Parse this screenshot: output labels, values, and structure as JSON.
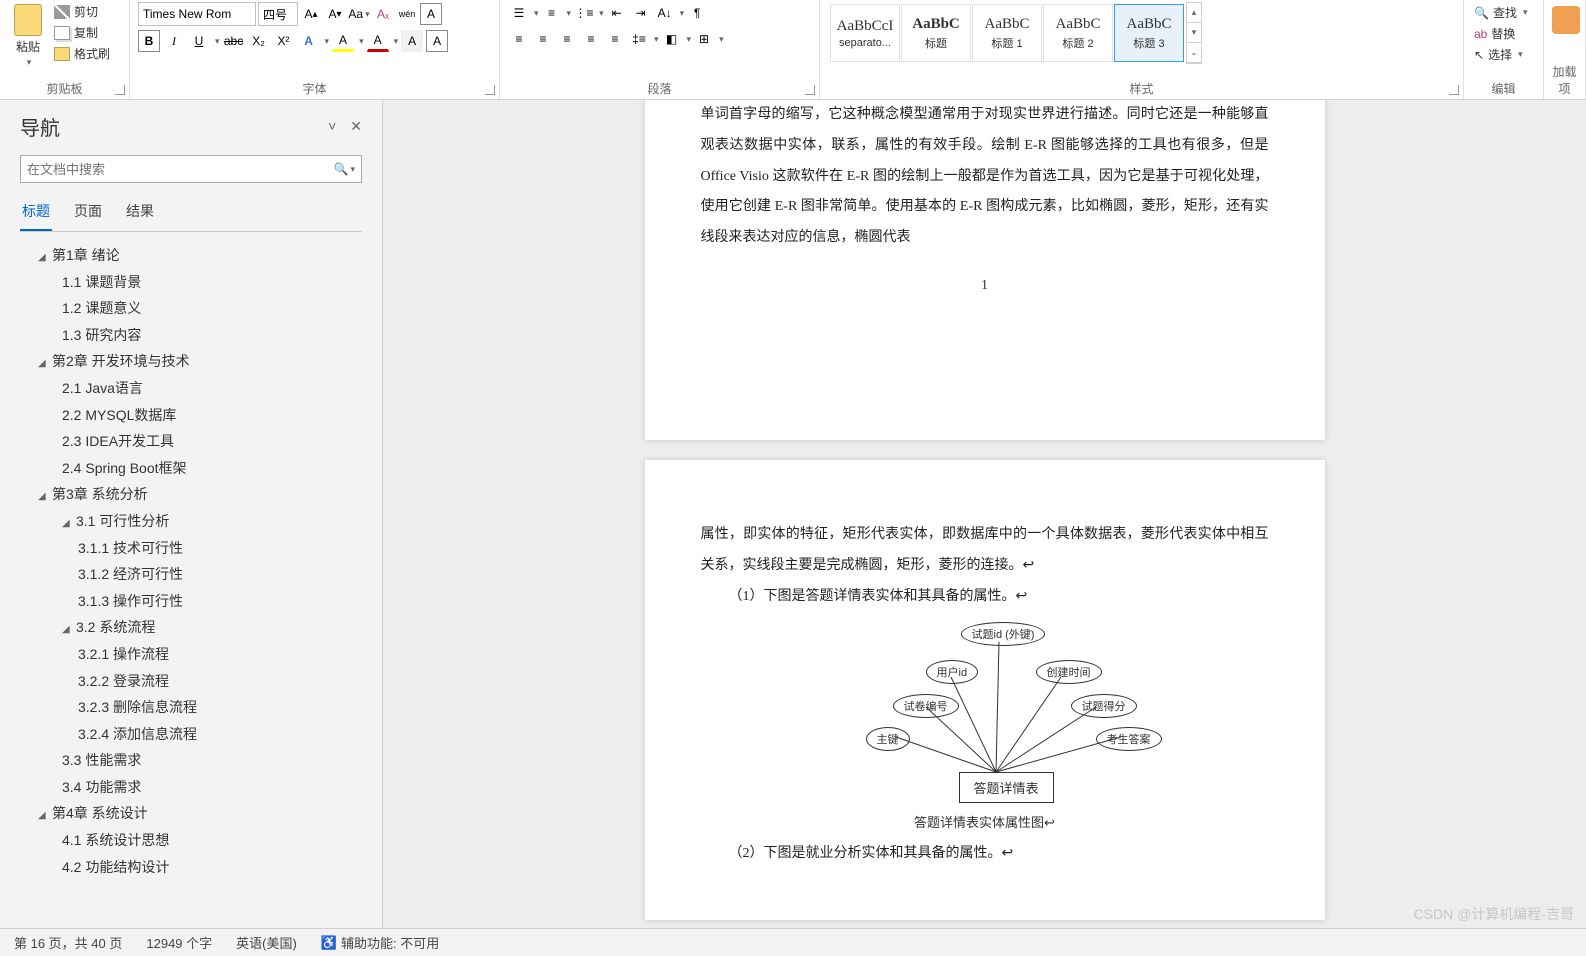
{
  "ribbon": {
    "clipboard": {
      "paste": "粘贴",
      "cut": "剪切",
      "copy": "复制",
      "brush": "格式刷",
      "label": "剪贴板"
    },
    "font": {
      "name": "Times New Rom",
      "size": "四号",
      "grow": "A",
      "shrink": "A",
      "case": "Aa",
      "clear": "Aₓ",
      "phonetic": "wén",
      "charbox": "A",
      "bold": "B",
      "italic": "I",
      "underline": "U",
      "strike": "abc",
      "sub": "X₂",
      "sup": "X²",
      "effects": "A",
      "highlight": "A",
      "fontcolor": "A",
      "charshade": "A",
      "charborder": "A",
      "label": "字体"
    },
    "para": {
      "label": "段落"
    },
    "styles": {
      "items": [
        {
          "preview": "AaBbCcI",
          "name": "separato...",
          "bold": false
        },
        {
          "preview": "AaBbC",
          "name": "标题",
          "bold": true
        },
        {
          "preview": "AaBbC",
          "name": "标题 1",
          "bold": false
        },
        {
          "preview": "AaBbC",
          "name": "标题 2",
          "bold": false
        },
        {
          "preview": "AaBbC",
          "name": "标题 3",
          "bold": false
        }
      ],
      "selected": 4,
      "label": "样式"
    },
    "edit": {
      "find": "查找",
      "replace": "替换",
      "select": "选择",
      "label": "编辑"
    },
    "addin": {
      "label": "加载项"
    }
  },
  "nav": {
    "title": "导航",
    "collapse": "˅",
    "close": "✕",
    "search_placeholder": "在文档中搜索",
    "tabs": {
      "headings": "标题",
      "pages": "页面",
      "results": "结果"
    },
    "tree": [
      {
        "lvl": 1,
        "caret": true,
        "text": "第1章 绪论"
      },
      {
        "lvl": 2,
        "caret": false,
        "text": "1.1 课题背景"
      },
      {
        "lvl": 2,
        "caret": false,
        "text": "1.2 课题意义"
      },
      {
        "lvl": 2,
        "caret": false,
        "text": "1.3 研究内容"
      },
      {
        "lvl": 1,
        "caret": true,
        "text": "第2章 开发环境与技术"
      },
      {
        "lvl": 2,
        "caret": false,
        "text": "2.1 Java语言"
      },
      {
        "lvl": 2,
        "caret": false,
        "text": "2.2 MYSQL数据库"
      },
      {
        "lvl": 2,
        "caret": false,
        "text": "2.3 IDEA开发工具"
      },
      {
        "lvl": 2,
        "caret": false,
        "text": "2.4 Spring Boot框架"
      },
      {
        "lvl": 1,
        "caret": true,
        "text": "第3章 系统分析"
      },
      {
        "lvl": 2,
        "caret": true,
        "text": "3.1 可行性分析"
      },
      {
        "lvl": 3,
        "caret": false,
        "text": "3.1.1 技术可行性"
      },
      {
        "lvl": 3,
        "caret": false,
        "text": "3.1.2 经济可行性"
      },
      {
        "lvl": 3,
        "caret": false,
        "text": "3.1.3 操作可行性"
      },
      {
        "lvl": 2,
        "caret": true,
        "text": "3.2 系统流程"
      },
      {
        "lvl": 3,
        "caret": false,
        "text": "3.2.1 操作流程"
      },
      {
        "lvl": 3,
        "caret": false,
        "text": "3.2.2 登录流程"
      },
      {
        "lvl": 3,
        "caret": false,
        "text": "3.2.3 删除信息流程"
      },
      {
        "lvl": 3,
        "caret": false,
        "text": "3.2.4 添加信息流程"
      },
      {
        "lvl": 2,
        "caret": false,
        "text": "3.3 性能需求"
      },
      {
        "lvl": 2,
        "caret": false,
        "text": "3.4 功能需求"
      },
      {
        "lvl": 1,
        "caret": true,
        "text": "第4章 系统设计"
      },
      {
        "lvl": 2,
        "caret": false,
        "text": "4.1 系统设计思想"
      },
      {
        "lvl": 2,
        "caret": false,
        "text": "4.2 功能结构设计"
      }
    ]
  },
  "doc": {
    "page1_text": "单词首字母的缩写，它这种概念模型通常用于对现实世界进行描述。同时它还是一种能够直观表达数据中实体，联系，属性的有效手段。绘制 E-R 图能够选择的工具也有很多，但是 Office Visio 这款软件在 E-R 图的绘制上一般都是作为首选工具，因为它是基于可视化处理，使用它创建 E-R 图非常简单。使用基本的 E-R 图构成元素，比如椭圆，菱形，矩形，还有实线段来表达对应的信息，椭圆代表",
    "page1_num": "1",
    "page2_text": "属性，即实体的特征，矩形代表实体，即数据库中的一个具体数据表，菱形代表实体中相互关系，实线段主要是完成椭圆，矩形，菱形的连接。↩",
    "page2_item1": "（1）下图是答题详情表实体和其具备的属性。↩",
    "er": {
      "entity": "答题详情表",
      "attrs": [
        "试题id (外键)",
        "用户id",
        "创建时间",
        "试卷编号",
        "试题得分",
        "主键",
        "考生答案"
      ]
    },
    "caption": "答题详情表实体属性图↩",
    "page2_item2": "（2）下图是就业分析实体和其具备的属性。↩"
  },
  "status": {
    "page": "第 16 页，共 40 页",
    "words": "12949 个字",
    "lang": "英语(美国)",
    "a11y": "辅助功能: 不可用"
  },
  "watermark": "CSDN @计算机编程-吉哥"
}
